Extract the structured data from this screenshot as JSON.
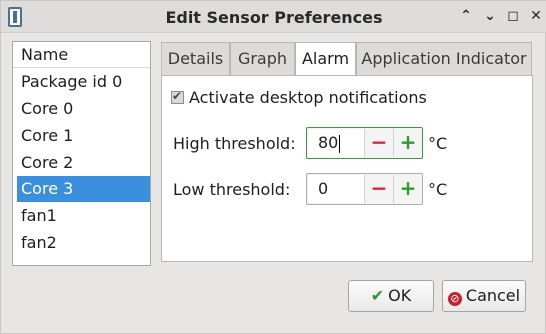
{
  "window": {
    "title": "Edit Sensor Preferences",
    "icons": [
      "app-icon",
      "chevron-up-icon",
      "chevron-down-icon",
      "maximize-icon",
      "close-icon"
    ]
  },
  "sensor_list": {
    "header": "Name",
    "items": [
      "Package id 0",
      "Core 0",
      "Core 1",
      "Core 2",
      "Core 3",
      "fan1",
      "fan2"
    ],
    "selected": "Core 3"
  },
  "tabs": {
    "items": [
      "Details",
      "Graph",
      "Alarm",
      "Application Indicator"
    ],
    "active": "Alarm"
  },
  "alarm": {
    "notifications_label": "Activate desktop notifications",
    "notifications_checked": true,
    "high_label": "High threshold:",
    "high_value": "80",
    "low_label": "Low threshold:",
    "low_value": "0",
    "minus": "−",
    "plus": "+",
    "unit": "°C"
  },
  "buttons": {
    "ok": "OK",
    "cancel": "Cancel"
  },
  "colors": {
    "selection": "#3b8fdc",
    "minus": "#d4233a",
    "plus": "#2a9c2a"
  }
}
